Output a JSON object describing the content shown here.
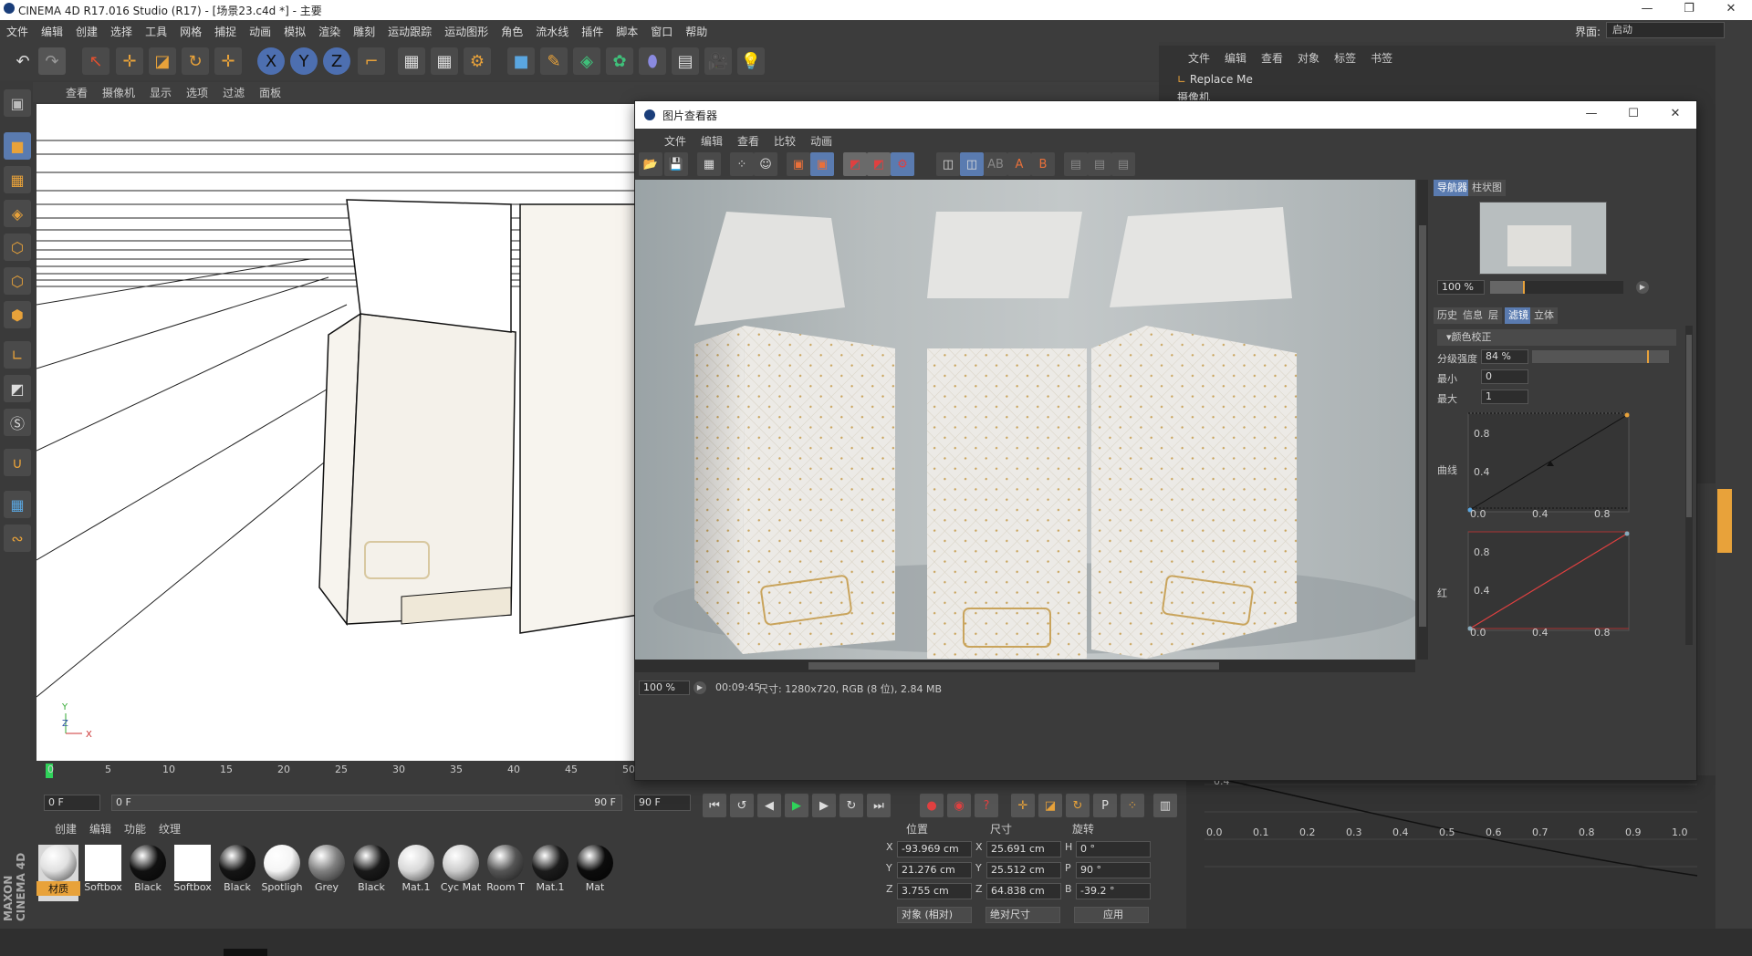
{
  "app": {
    "title": "CINEMA 4D R17.016 Studio (R17) - [场景23.c4d *] - 主要",
    "menus": [
      "文件",
      "编辑",
      "创建",
      "选择",
      "工具",
      "网格",
      "捕捉",
      "动画",
      "模拟",
      "渲染",
      "雕刻",
      "运动跟踪",
      "运动图形",
      "角色",
      "流水线",
      "插件",
      "脚本",
      "窗口",
      "帮助"
    ],
    "layout_label": "界面:",
    "layout_value": "启动"
  },
  "viewport": {
    "menus": [
      "查看",
      "摄像机",
      "显示",
      "选项",
      "过滤",
      "面板"
    ],
    "axis_y": "Y",
    "axis_z": "Z",
    "axis_x": "X"
  },
  "timeline": {
    "ticks": [
      "0",
      "5",
      "10",
      "15",
      "20",
      "25",
      "30",
      "35",
      "40",
      "45",
      "50"
    ],
    "current_frame": "0 F",
    "start_field": "0 F",
    "end_field": "90 F",
    "end_field2": "90 F"
  },
  "object_manager": {
    "menus": [
      "文件",
      "编辑",
      "查看",
      "对象",
      "标签",
      "书签"
    ],
    "items": [
      "Replace Me",
      "摄像机"
    ]
  },
  "materials": {
    "menus": [
      "创建",
      "编辑",
      "功能",
      "纹理"
    ],
    "items": [
      {
        "name": "材质",
        "color": "#e0e0e0"
      },
      {
        "name": "Softbox",
        "color": "#ffffff"
      },
      {
        "name": "Black",
        "color": "#111111"
      },
      {
        "name": "Softbox",
        "color": "#ffffff"
      },
      {
        "name": "Black",
        "color": "#151515"
      },
      {
        "name": "Spotligh",
        "color": "#f5f5f5"
      },
      {
        "name": "Grey",
        "color": "#808080"
      },
      {
        "name": "Black",
        "color": "#1a1a1a"
      },
      {
        "name": "Mat.1",
        "color": "#d8d8d8"
      },
      {
        "name": "Cyc Mat",
        "color": "#cccccc"
      },
      {
        "name": "Room T",
        "color": "#555555"
      },
      {
        "name": "Mat.1",
        "color": "#1c1c1c"
      },
      {
        "name": "Mat",
        "color": "#0c0c0c"
      }
    ]
  },
  "coords": {
    "headers": [
      "位置",
      "尺寸",
      "旋转"
    ],
    "rows": [
      {
        "axis": "X",
        "pos": "-93.969 cm",
        "saxis": "X",
        "size": "25.691 cm",
        "raxis": "H",
        "rot": "0 °"
      },
      {
        "axis": "Y",
        "pos": "21.276 cm",
        "saxis": "Y",
        "size": "25.512 cm",
        "raxis": "P",
        "rot": "90 °"
      },
      {
        "axis": "Z",
        "pos": "3.755 cm",
        "saxis": "Z",
        "size": "64.838 cm",
        "raxis": "B",
        "rot": "-39.2 °"
      }
    ],
    "mode": "对象 (相对)",
    "size_mode": "绝对尺寸",
    "apply": "应用"
  },
  "picture_viewer": {
    "title": "图片查看器",
    "menus": [
      "文件",
      "编辑",
      "查看",
      "比较",
      "动画"
    ],
    "zoom": "100 %",
    "time": "00:09:45",
    "info": "尺寸: 1280x720, RGB (8 位), 2.84 MB",
    "nav_tabs": [
      "导航器",
      "柱状图"
    ],
    "nav_zoom": "100 %",
    "tabs": [
      "历史",
      "信息",
      "层",
      "滤镜",
      "立体"
    ],
    "section": "颜色校正",
    "strength_label": "分级强度",
    "strength_value": "84 %",
    "min_label": "最小",
    "min_value": "0",
    "max_label": "最大",
    "max_value": "1",
    "curve_label": "曲线",
    "red_label": "红",
    "curve_ticks_y": [
      "0.8",
      "0.4"
    ],
    "curve_ticks_x": [
      "0.0",
      "0.4",
      "0.8"
    ]
  },
  "graph_ticks": [
    "0.0",
    "0.1",
    "0.2",
    "0.3",
    "0.4",
    "0.5",
    "0.6",
    "0.7",
    "0.8",
    "0.9",
    "1.0"
  ],
  "graph_y": "0.4"
}
